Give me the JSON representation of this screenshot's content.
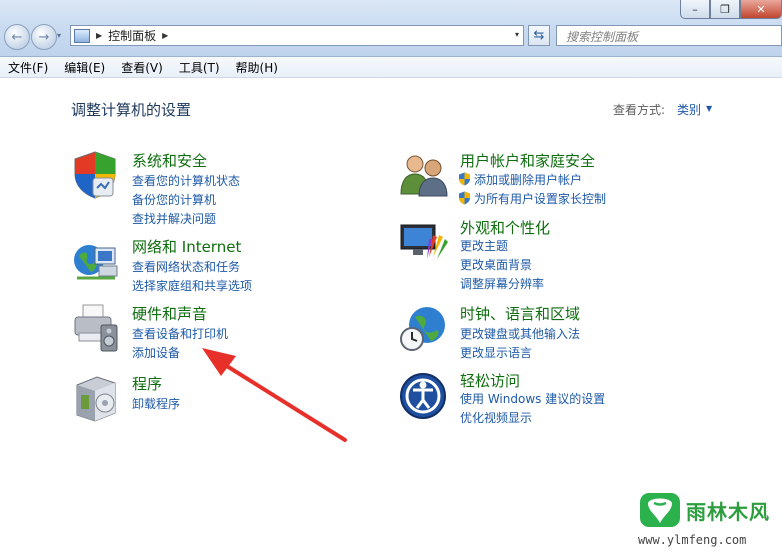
{
  "window": {
    "caption_buttons": {
      "minimize": "–",
      "maximize": "❐",
      "close": "✕"
    }
  },
  "nav": {
    "back_glyph": "←",
    "forward_glyph": "→",
    "dropdown_glyph": "▾",
    "address_icon": "control-panel-icon",
    "breadcrumb": "控制面板",
    "sep_glyph": "▶",
    "refresh_glyph": "⇆",
    "search_placeholder": "搜索控制面板"
  },
  "menubar": {
    "items": [
      "文件(F)",
      "编辑(E)",
      "查看(V)",
      "工具(T)",
      "帮助(H)"
    ]
  },
  "page": {
    "heading": "调整计算机的设置",
    "viewby_label": "查看方式:",
    "viewby_value": "类别",
    "viewby_arrow": "▼"
  },
  "categories": {
    "system": {
      "icon": "shield-icon",
      "title": "系统和安全",
      "links": [
        "查看您的计算机状态",
        "备份您的计算机",
        "查找并解决问题"
      ]
    },
    "network": {
      "icon": "globe-network-icon",
      "title": "网络和 Internet",
      "links": [
        "查看网络状态和任务",
        "选择家庭组和共享选项"
      ]
    },
    "hardware": {
      "icon": "printer-icon",
      "title": "硬件和声音",
      "links": [
        "查看设备和打印机",
        "添加设备"
      ]
    },
    "programs": {
      "icon": "programs-box-icon",
      "title": "程序",
      "links": [
        "卸载程序"
      ]
    },
    "users": {
      "icon": "users-icon",
      "title": "用户帐户和家庭安全",
      "links": [
        "添加或删除用户帐户",
        "为所有用户设置家长控制"
      ]
    },
    "appearance": {
      "icon": "monitor-palette-icon",
      "title": "外观和个性化",
      "links": [
        "更改主题",
        "更改桌面背景",
        "调整屏幕分辨率"
      ]
    },
    "clock": {
      "icon": "clock-globe-icon",
      "title": "时钟、语言和区域",
      "links": [
        "更改键盘或其他输入法",
        "更改显示语言"
      ]
    },
    "ease": {
      "icon": "ease-of-access-icon",
      "title": "轻松访问",
      "links": [
        "使用 Windows 建议的设置",
        "优化视频显示"
      ]
    }
  },
  "watermark": {
    "name": "雨林木风",
    "url": "www.ylmfeng.com"
  },
  "colors": {
    "title_green": "#0e6e0e",
    "link_blue": "#1e5aa8",
    "heading_navy": "#1e395b",
    "annotation_red": "#e8302a"
  }
}
